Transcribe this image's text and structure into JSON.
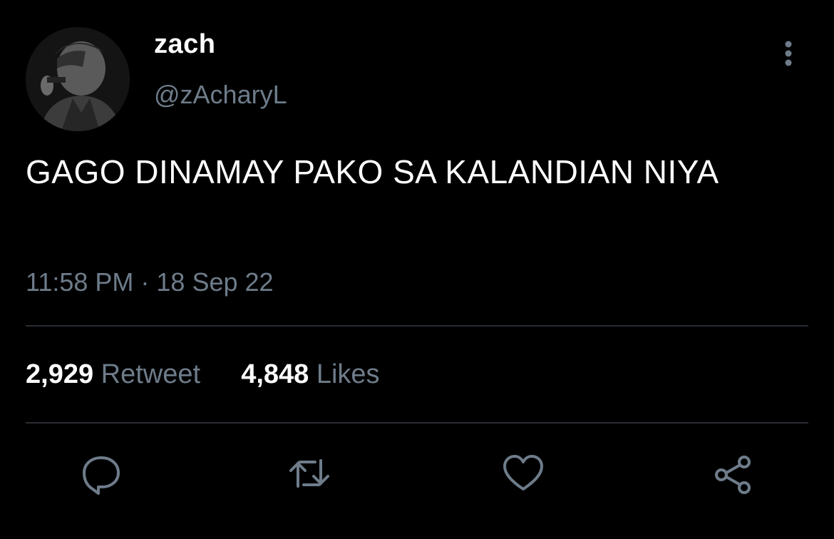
{
  "author": {
    "display_name": "zach",
    "handle": "@zAcharyL",
    "avatar_icon": "profile-photo"
  },
  "tweet": {
    "text": "GAGO DINAMAY PAKO SA KALANDIAN NIYA",
    "timestamp": "11:58 PM · 18 Sep 22"
  },
  "stats": {
    "retweets_count": "2,929",
    "retweets_label": "Retweet",
    "likes_count": "4,848",
    "likes_label": "Likes"
  },
  "actions": [
    {
      "name": "reply",
      "icon": "speech-bubble-icon"
    },
    {
      "name": "retweet",
      "icon": "retweet-arrows-icon"
    },
    {
      "name": "like",
      "icon": "heart-icon"
    },
    {
      "name": "share",
      "icon": "share-nodes-icon"
    }
  ],
  "colors": {
    "background": "#000000",
    "primary_text": "#ffffff",
    "secondary_text": "#6e7c8a",
    "divider": "#2a2e33",
    "icon": "#6e7c8a"
  }
}
